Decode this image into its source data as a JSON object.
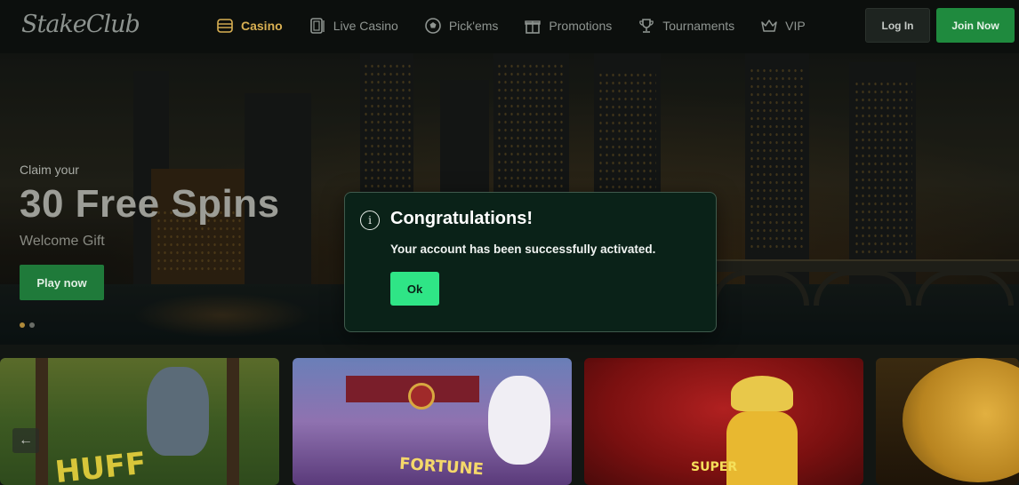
{
  "brand": {
    "logo_text": "StakeClub"
  },
  "nav": {
    "items": [
      {
        "label": "Casino",
        "icon": "casino-chips-icon",
        "active": true
      },
      {
        "label": "Live Casino",
        "icon": "live-casino-cards-icon",
        "active": false
      },
      {
        "label": "Pick'ems",
        "icon": "soccer-ball-icon",
        "active": false
      },
      {
        "label": "Promotions",
        "icon": "gift-icon",
        "active": false
      },
      {
        "label": "Tournaments",
        "icon": "trophy-icon",
        "active": false
      },
      {
        "label": "VIP",
        "icon": "crown-icon",
        "active": false
      }
    ]
  },
  "auth": {
    "login_label": "Log In",
    "join_label": "Join Now"
  },
  "hero": {
    "claim": "Claim your",
    "title": "30 Free Spins",
    "subtitle": "Welcome Gift",
    "cta_label": "Play now",
    "slide_count": 2,
    "active_slide": 1
  },
  "modal": {
    "icon": "info-icon",
    "title": "Congratulations!",
    "message": "Your account has been successfully activated.",
    "ok_label": "Ok"
  },
  "games": [
    {
      "title": "HUFF",
      "theme": "wolf-forest"
    },
    {
      "title": "FORTUNE",
      "theme": "rabbit-temple"
    },
    {
      "title": "SUPER",
      "theme": "mariachi"
    },
    {
      "title": "",
      "theme": "moon-night"
    }
  ],
  "colors": {
    "accent_gold": "#d9b053",
    "join_green": "#1f8a3e",
    "ok_green": "#2fe586",
    "modal_bg": "#0a2218",
    "page_bg": "#121613"
  }
}
